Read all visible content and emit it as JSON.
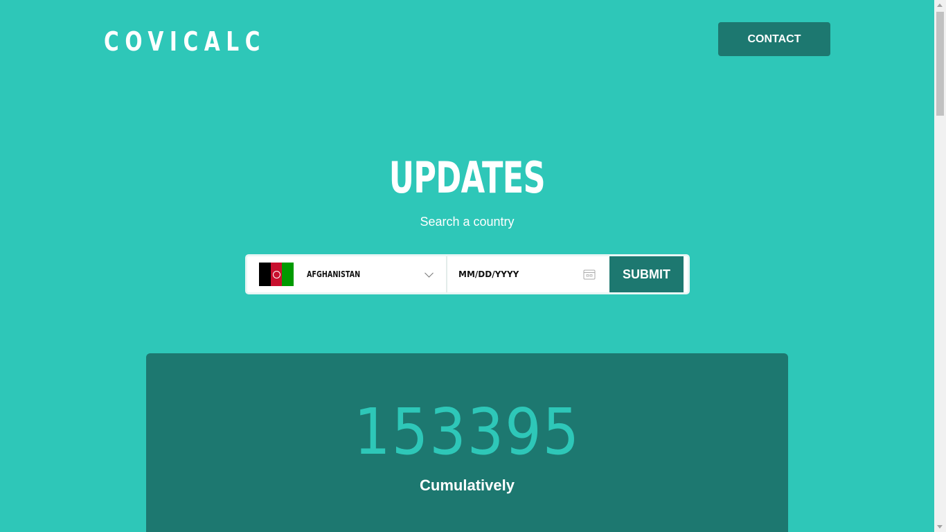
{
  "header": {
    "logo": "COVICALC",
    "contact_label": "CONTACT"
  },
  "hero": {
    "title": "UPDATES",
    "subtitle": "Search a country"
  },
  "search": {
    "country": "AFGHANISTAN",
    "flag_icon": "afghanistan-flag-icon",
    "date_placeholder": "MM/DD/YYYY",
    "submit_label": "SUBMIT"
  },
  "stats": {
    "value": "153395",
    "label": "Cumulatively"
  },
  "colors": {
    "background": "#2ec7b8",
    "accent_dark": "#1d7870",
    "text": "#ffffff"
  }
}
